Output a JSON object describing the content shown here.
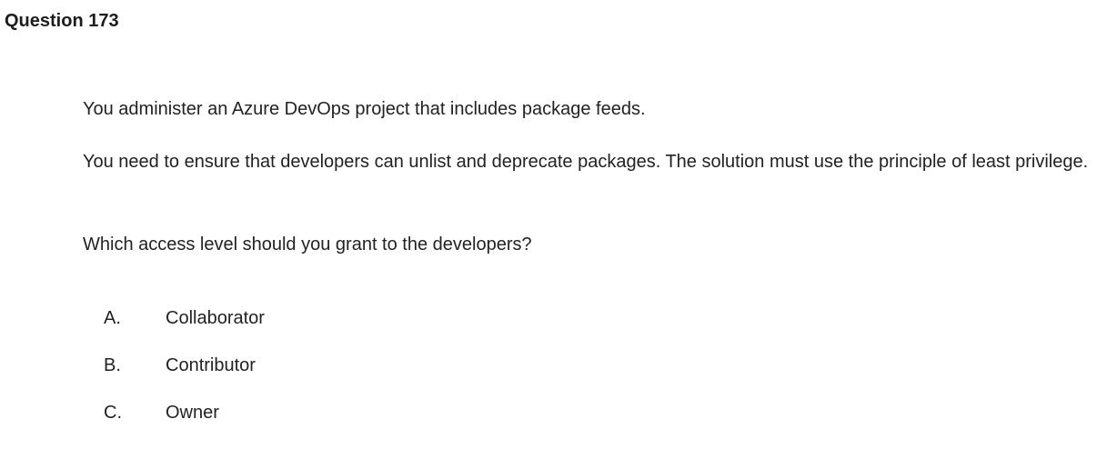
{
  "question": {
    "title": "Question 173",
    "paragraphs": [
      "You administer an Azure DevOps project that includes package feeds.",
      "You need to ensure that developers can unlist and deprecate packages. The solution must use the principle of least privilege.",
      "Which access level should you grant to the developers?"
    ],
    "options": [
      {
        "letter": "A.",
        "text": "Collaborator"
      },
      {
        "letter": "B.",
        "text": "Contributor"
      },
      {
        "letter": "C.",
        "text": "Owner"
      }
    ]
  }
}
